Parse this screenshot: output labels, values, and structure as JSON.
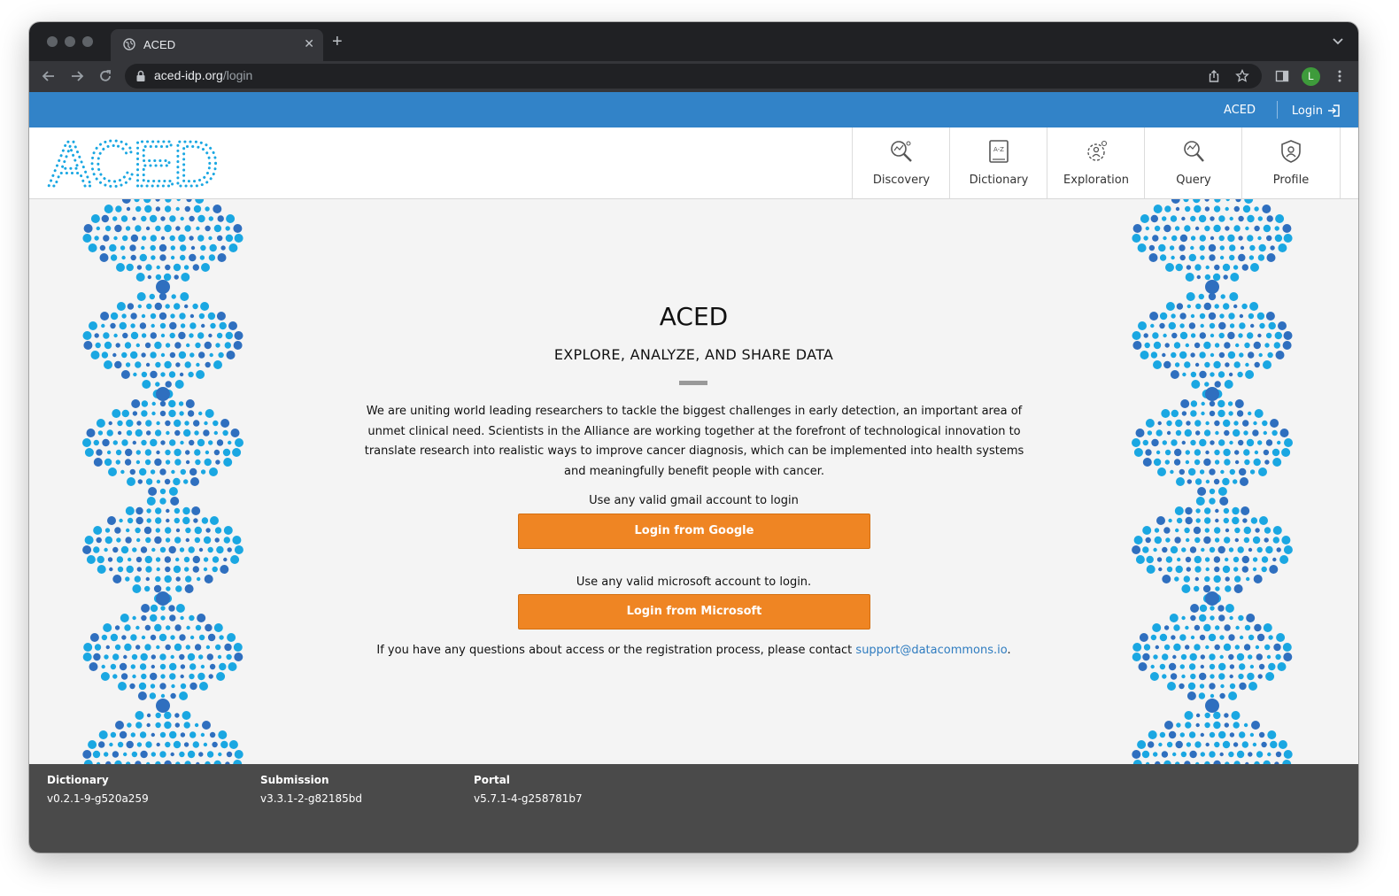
{
  "browser": {
    "tab_title": "ACED",
    "url_host": "aced-idp.org",
    "url_path": "/login",
    "profile_initial": "L"
  },
  "topbar": {
    "aced_link": "ACED",
    "login_link": "Login"
  },
  "header": {
    "logo_text": "ACED",
    "nav": [
      {
        "label": "Discovery",
        "icon": "discovery-icon"
      },
      {
        "label": "Dictionary",
        "icon": "dictionary-icon"
      },
      {
        "label": "Exploration",
        "icon": "exploration-icon"
      },
      {
        "label": "Query",
        "icon": "query-icon"
      },
      {
        "label": "Profile",
        "icon": "profile-icon"
      }
    ]
  },
  "main": {
    "title": "ACED",
    "subtitle": "EXPLORE, ANALYZE, AND SHARE DATA",
    "intro": "We are uniting world leading researchers to tackle the biggest challenges in early detection, an important area of unmet clinical need. Scientists in the Alliance are working together at the forefront of technological innovation to translate research into realistic ways to improve cancer diagnosis, which can be implemented into health systems and meaningfully benefit people with cancer.",
    "google_hint": "Use any valid gmail account to login",
    "google_button": "Login from Google",
    "microsoft_hint": "Use any valid microsoft account to login.",
    "microsoft_button": "Login from Microsoft",
    "contact_prefix": "If you have any questions about access or the registration process, please contact ",
    "contact_email": "support@datacommons.io",
    "contact_suffix": "."
  },
  "footer": {
    "dictionary_label": "Dictionary",
    "dictionary_version": "v0.2.1-9-g520a259",
    "submission_label": "Submission",
    "submission_version": "v3.3.1-2-g82185bd",
    "portal_label": "Portal",
    "portal_version": "v5.7.1-4-g258781b7"
  },
  "colors": {
    "topbar": "#3283c8",
    "button": "#ef8523",
    "footer": "#4a4a4a",
    "dna_light": "#1aa7e2",
    "dna_dark": "#2f6fbf"
  }
}
